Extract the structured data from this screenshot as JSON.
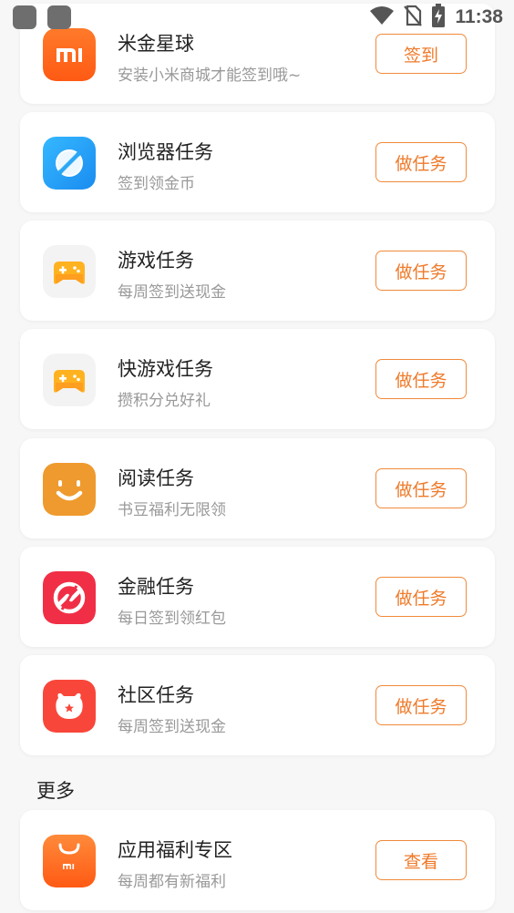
{
  "status_bar": {
    "time": "11:38",
    "icons": [
      "wifi-icon",
      "no-sim-icon",
      "battery-charging-icon"
    ]
  },
  "tasks": [
    {
      "title": "米金星球",
      "subtitle": "安装小米商城才能签到哦~",
      "button": "签到",
      "icon": "mi-logo-icon",
      "color": "#ff6a1f"
    },
    {
      "title": "浏览器任务",
      "subtitle": "签到领金币",
      "button": "做任务",
      "icon": "browser-icon",
      "color": "#2aa7f5"
    },
    {
      "title": "游戏任务",
      "subtitle": "每周签到送现金",
      "button": "做任务",
      "icon": "gamepad-icon",
      "color": "#ffb21f"
    },
    {
      "title": "快游戏任务",
      "subtitle": "攒积分兑好礼",
      "button": "做任务",
      "icon": "quick-game-icon",
      "color": "#ffb21f"
    },
    {
      "title": "阅读任务",
      "subtitle": "书豆福利无限领",
      "button": "做任务",
      "icon": "reading-icon",
      "color": "#ef9a2e"
    },
    {
      "title": "金融任务",
      "subtitle": "每日签到领红包",
      "button": "做任务",
      "icon": "finance-icon",
      "color": "#f02f46"
    },
    {
      "title": "社区任务",
      "subtitle": "每周签到送现金",
      "button": "做任务",
      "icon": "community-icon",
      "color": "#f8473a"
    }
  ],
  "more_section": {
    "heading": "更多",
    "item": {
      "title": "应用福利专区",
      "subtitle": "每周都有新福利",
      "button": "查看",
      "icon": "app-store-icon",
      "color": "#ff6a1f"
    }
  }
}
